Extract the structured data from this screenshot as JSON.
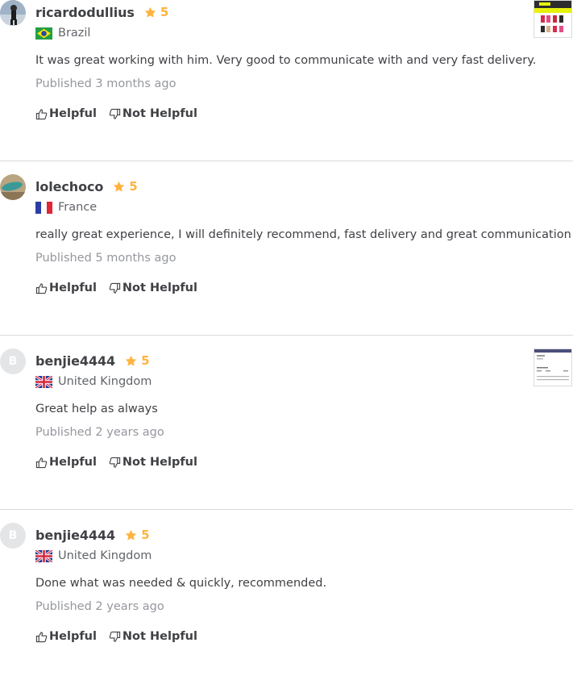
{
  "reviews": [
    {
      "username": "ricardodullius",
      "rating": "5",
      "country": "Brazil",
      "comment": "It was great working with him. Very good to communicate with and very fast delivery.",
      "published": "Published 3 months ago",
      "helpful": "Helpful",
      "not_helpful": "Not Helpful"
    },
    {
      "username": "lolechoco",
      "rating": "5",
      "country": "France",
      "comment": "really great experience, I will definitely recommend, fast delivery and great communication !",
      "published": "Published 5 months ago",
      "helpful": "Helpful",
      "not_helpful": "Not Helpful"
    },
    {
      "username": "benjie4444",
      "avatar_letter": "B",
      "rating": "5",
      "country": "United Kingdom",
      "comment": "Great help as always",
      "published": "Published 2 years ago",
      "helpful": "Helpful",
      "not_helpful": "Not Helpful"
    },
    {
      "username": "benjie4444",
      "avatar_letter": "B",
      "rating": "5",
      "country": "United Kingdom",
      "comment": "Done what was needed & quickly, recommended.",
      "published": "Published 2 years ago",
      "helpful": "Helpful",
      "not_helpful": "Not Helpful"
    }
  ],
  "colors": {
    "star": "#ffb33e",
    "text": "#404145",
    "muted": "#95979d",
    "divider": "#dadbdd"
  }
}
